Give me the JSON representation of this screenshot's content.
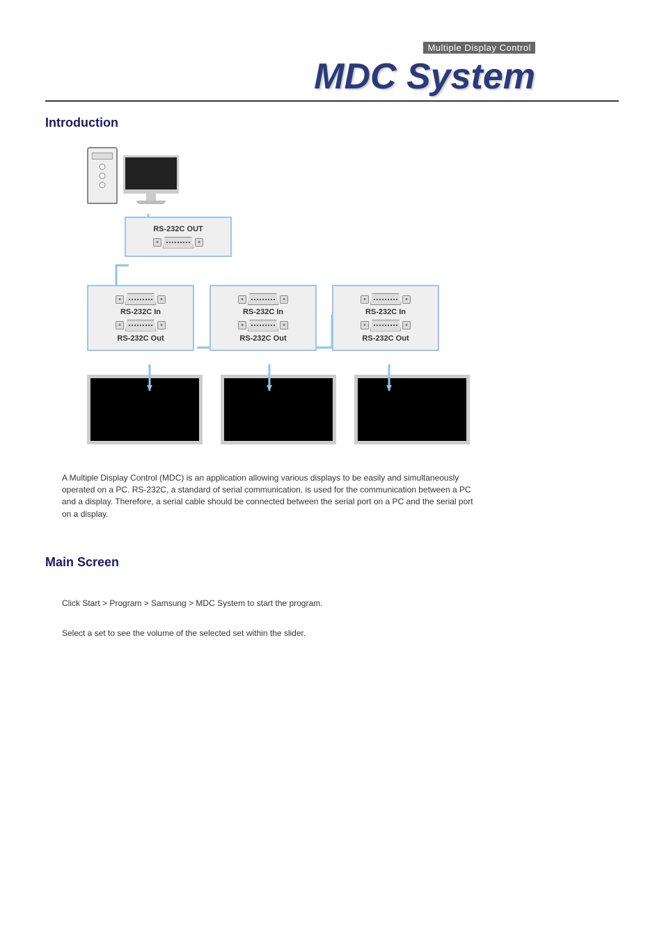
{
  "header": {
    "tagline": "Multiple Display Control",
    "title": "MDC System"
  },
  "sections": {
    "intro": {
      "heading": "Introduction",
      "diagram": {
        "pc_out_label": "RS-232C OUT",
        "unit_in_label": "RS-232C In",
        "unit_out_label": "RS-232C Out"
      },
      "description": "A Multiple Display Control (MDC) is an application allowing various displays to be easily and simultaneously operated on a PC. RS-232C, a standard of serial communication, is used for the communication between a PC and a display. Therefore, a serial cable should be connected between the serial port on a PC and the serial port on a display."
    },
    "main_screen": {
      "heading": "Main Screen",
      "line1": "Click Start > Program > Samsung > MDC System to start the program.",
      "line2": "Select a set to see the volume of the selected set within the slider."
    }
  }
}
